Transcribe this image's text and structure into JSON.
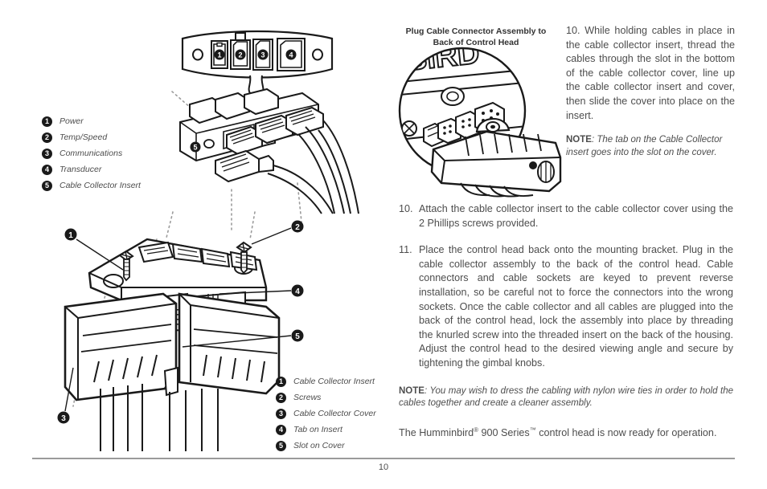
{
  "document": {
    "page_number": "10"
  },
  "figure_top": {
    "callouts": [
      "1",
      "2",
      "3",
      "4",
      "5"
    ]
  },
  "legend_top": {
    "items": [
      {
        "num": "1",
        "label": "Power"
      },
      {
        "num": "2",
        "label": "Temp/Speed"
      },
      {
        "num": "3",
        "label": "Communications"
      },
      {
        "num": "4",
        "label": "Transducer"
      },
      {
        "num": "5",
        "label": "Cable Collector Insert"
      }
    ]
  },
  "legend_bottom": {
    "items": [
      {
        "num": "1",
        "label": "Cable Collector Insert"
      },
      {
        "num": "2",
        "label": "Screws"
      },
      {
        "num": "3",
        "label": "Cable Collector Cover"
      },
      {
        "num": "4",
        "label": "Tab on Insert"
      },
      {
        "num": "5",
        "label": "Slot on Cover"
      }
    ]
  },
  "figure_bottom_left": {
    "callouts": [
      "1",
      "2",
      "3",
      "4",
      "5"
    ]
  },
  "figure_right": {
    "caption": "Plug Cable Connector Assembly to Back of Control Head",
    "caption_line1": "Plug Cable Connector Assembly to",
    "caption_line2": "Back of Control Head",
    "logo_text": "BIRD"
  },
  "body": {
    "step10_side": {
      "number": "10.",
      "text": "While holding cables in place in the cable collector insert, thread the cables through the slot in the bottom of the cable collector cover, line up the cable collector insert and cover, then slide the cover into place on the insert."
    },
    "note_side": {
      "label": "NOTE",
      "text": ": The tab on the Cable Collector insert goes into the slot on the cover."
    },
    "step10": {
      "number": "10.",
      "text": "Attach the cable collector insert to the cable collector cover using the 2 Phillips screws provided."
    },
    "step11": {
      "number": "11.",
      "text": "Place the control head back onto the mounting bracket. Plug in the cable collector assembly to the back of the control head. Cable connectors and cable sockets are keyed to prevent reverse installation, so be careful not to force the connectors into the wrong sockets. Once the cable collector and all cables are plugged into the back of the control head, lock the assembly into place by threading the knurled screw into the threaded insert on the back of the housing. Adjust the control head to the desired viewing angle and secure by tightening the gimbal knobs."
    },
    "note_main": {
      "label": "NOTE",
      "text": ": You may wish to dress the cabling with nylon wire ties in order to hold the cables together and create a cleaner assembly."
    },
    "closing": {
      "text_part1": "The Humminbird",
      "sup1": "®",
      "text_part2": " 900 Series",
      "sup2": "™",
      "text_part3": " control head is now ready for operation."
    }
  },
  "colors": {
    "ink": "#1a1a1a",
    "text": "#4d4d4d",
    "rule": "#9a9a9a",
    "dash": "#9b9b9b"
  }
}
